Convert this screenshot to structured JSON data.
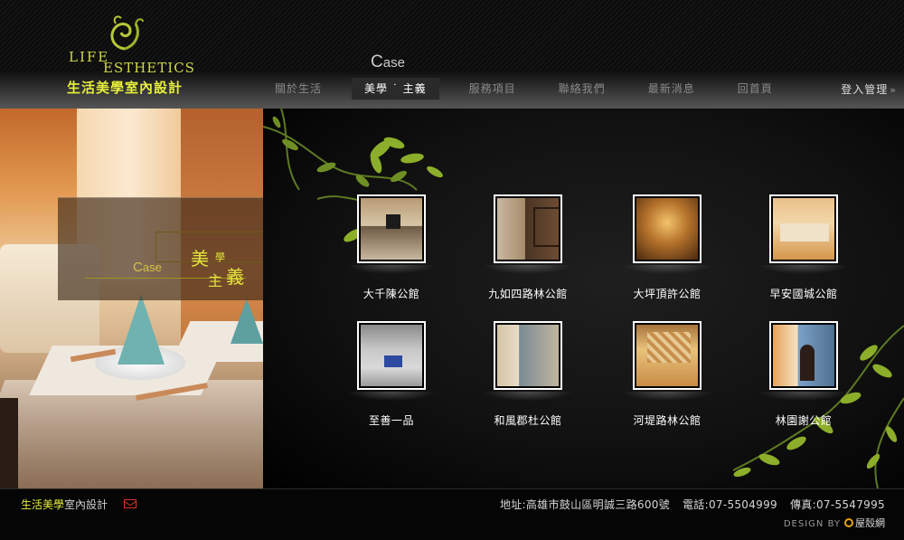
{
  "header": {
    "logo_life": "LIFE",
    "logo_esthetics": "ESTHETICS",
    "logo_chinese": "生活美學室內設計",
    "section_title_initial": "C",
    "section_title_rest": "ase",
    "admin_label": "登入管理"
  },
  "nav": {
    "items": [
      {
        "label": "關於生活"
      },
      {
        "label": "美學 ˙ 主義"
      },
      {
        "label": "服務項目"
      },
      {
        "label": "聯絡我們"
      },
      {
        "label": "最新消息"
      },
      {
        "label": "回首頁"
      }
    ]
  },
  "banner": {
    "case_initial": "C",
    "case_rest": "ase",
    "mei": "美",
    "xue": "學",
    "zhu": "主",
    "yi": "義"
  },
  "cases": [
    {
      "label": "大千陳公館",
      "icon": "project-photo"
    },
    {
      "label": "九如四路林公館",
      "icon": "project-photo"
    },
    {
      "label": "大坪頂許公館",
      "icon": "project-photo"
    },
    {
      "label": "早安國城公館",
      "icon": "project-photo"
    },
    {
      "label": "至善一品",
      "icon": "project-photo"
    },
    {
      "label": "和風郡杜公館",
      "icon": "project-photo"
    },
    {
      "label": "河堤路林公館",
      "icon": "project-photo"
    },
    {
      "label": "林園謝公館",
      "icon": "project-photo"
    }
  ],
  "footer": {
    "brand_highlight": "生活美學",
    "brand_rest": "室內設計",
    "address": "地址:高雄市鼓山區明誠三路600號",
    "phone": "電話:07-5504999",
    "fax": "傳真:07-5547995",
    "design_by": "DESIGN BY",
    "designer": "屋殼網"
  },
  "colors": {
    "accent_yellow": "#e6ef3c",
    "leaf_green": "#8cae2a",
    "mail_red": "#d9332a"
  }
}
